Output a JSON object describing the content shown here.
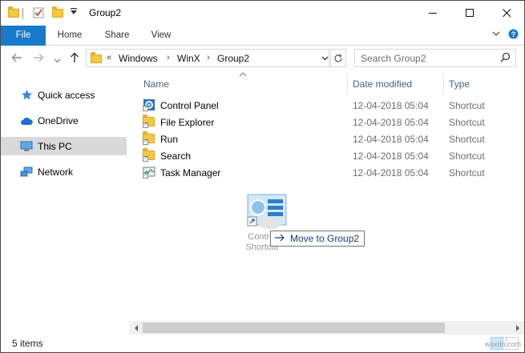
{
  "window": {
    "title": "Group2"
  },
  "title_controls": {
    "minimize": "—",
    "maximize": "☐",
    "close": "✕"
  },
  "ribbon": {
    "tabs": [
      "File",
      "Home",
      "Share",
      "View"
    ],
    "expand_icon": "chevron-down-icon",
    "help_icon": "help-icon"
  },
  "address": {
    "overflow": "«",
    "crumbs": [
      "Windows",
      "WinX",
      "Group2"
    ],
    "separator": "›"
  },
  "search": {
    "placeholder": "Search Group2"
  },
  "nav_pane": {
    "items": [
      {
        "label": "Quick access",
        "icon": "star-icon",
        "selected": false
      },
      {
        "label": "OneDrive",
        "icon": "cloud-icon",
        "selected": false
      },
      {
        "label": "This PC",
        "icon": "computer-icon",
        "selected": true
      },
      {
        "label": "Network",
        "icon": "network-icon",
        "selected": false
      }
    ]
  },
  "columns": {
    "name": "Name",
    "date": "Date modified",
    "type": "Type"
  },
  "files": [
    {
      "name": "Control Panel",
      "date": "12-04-2018 05:04",
      "type": "Shortcut",
      "icon": "control-panel-icon"
    },
    {
      "name": "File Explorer",
      "date": "12-04-2018 05:04",
      "type": "Shortcut",
      "icon": "folder-icon"
    },
    {
      "name": "Run",
      "date": "12-04-2018 05:04",
      "type": "Shortcut",
      "icon": "folder-icon"
    },
    {
      "name": "Search",
      "date": "12-04-2018 05:04",
      "type": "Shortcut",
      "icon": "folder-icon"
    },
    {
      "name": "Task Manager",
      "date": "12-04-2018 05:04",
      "type": "Shortcut",
      "icon": "task-manager-icon"
    }
  ],
  "drag": {
    "label_line1": "Control",
    "label_line2": "Shortcut",
    "tooltip": "Move to Group2"
  },
  "status": {
    "items": "5 items"
  },
  "watermark": "wsxdn.com",
  "colors": {
    "accent": "#1979ca",
    "selected": "#d9d9d9",
    "header_text": "#4c607a"
  }
}
